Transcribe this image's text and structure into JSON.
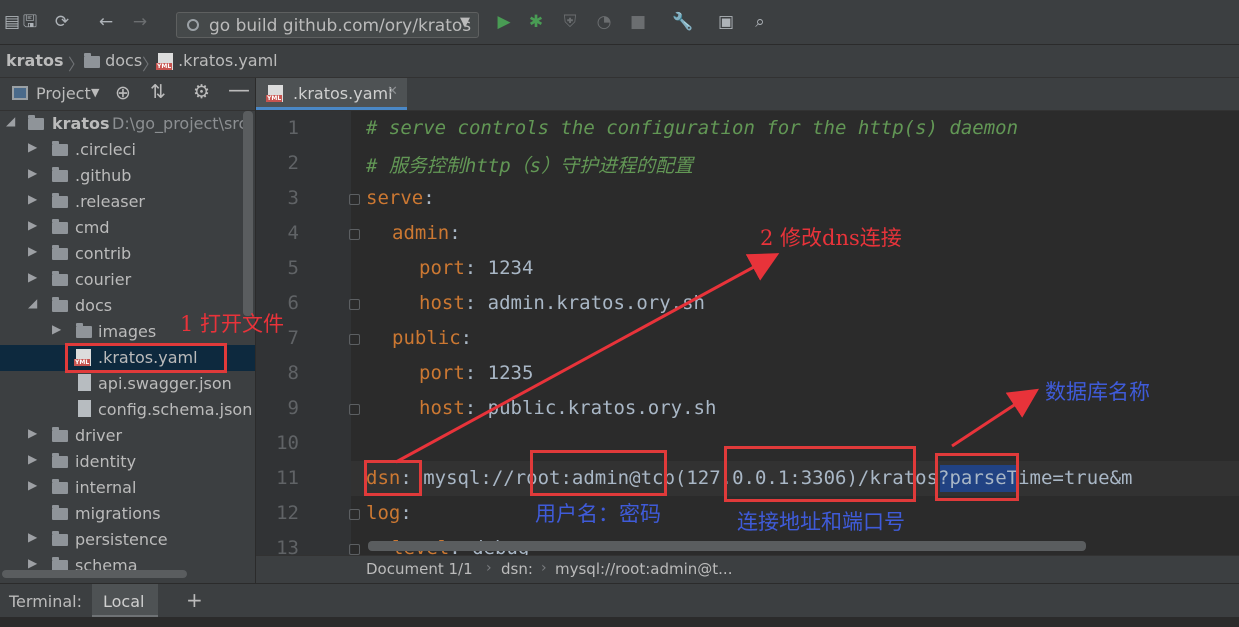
{
  "toolbar": {
    "run_config_label": "go build github.com/ory/kratos",
    "icons": [
      "save-icon",
      "sync-icon",
      "back-arrow-icon",
      "forward-arrow-icon",
      "run-icon",
      "debug-icon",
      "coverage-icon",
      "profile-icon",
      "stop-icon",
      "wrench-icon",
      "structure-icon",
      "search-icon"
    ]
  },
  "breadcrumb": {
    "items": [
      "kratos",
      "docs",
      ".kratos.yaml"
    ]
  },
  "project_panel": {
    "view_label": "Project",
    "root_name": "kratos",
    "root_path": "D:\\go_project\\src\\",
    "items": [
      {
        "label": ".circleci"
      },
      {
        "label": ".github"
      },
      {
        "label": ".releaser"
      },
      {
        "label": "cmd"
      },
      {
        "label": "contrib"
      },
      {
        "label": "courier"
      },
      {
        "label": "docs"
      },
      {
        "label": "images"
      },
      {
        "label": ".kratos.yaml"
      },
      {
        "label": "api.swagger.json"
      },
      {
        "label": "config.schema.json"
      },
      {
        "label": "driver"
      },
      {
        "label": "identity"
      },
      {
        "label": "internal"
      },
      {
        "label": "migrations"
      },
      {
        "label": "persistence"
      },
      {
        "label": "schema"
      }
    ]
  },
  "editor": {
    "tab_label": ".kratos.yaml",
    "line_numbers": [
      "1",
      "2",
      "3",
      "4",
      "5",
      "6",
      "7",
      "8",
      "9",
      "10",
      "11",
      "12",
      "13"
    ],
    "lines": {
      "l1": "# serve controls the configuration for the http(s) daemon",
      "l2": "# 服务控制http（s）守护进程的配置",
      "l3_key": "serve",
      "l4_key": "admin",
      "l5_key": "port",
      "l5_val": "1234",
      "l6_key": "host",
      "l6_val": "admin.kratos.ory.sh",
      "l7_key": "public",
      "l8_key": "port",
      "l8_val": "1235",
      "l9_key": "host",
      "l9_val": "public.kratos.ory.sh",
      "l11_key": "dsn",
      "l11_scheme": "mysql://",
      "l11_user": "root:admin",
      "l11_mid": "@tcp(",
      "l11_host": "127.0.0.1:3306",
      "l11_close": ")/",
      "l11_db": "kratos",
      "l11_rest": "?parseTime=true&m",
      "l12_key": "log",
      "l13_key": "level",
      "l13_val": "debug"
    }
  },
  "status_bar": {
    "document": "Document 1/1",
    "crumb1": "dsn:",
    "crumb2": "mysql://root:admin@t..."
  },
  "terminal": {
    "label": "Terminal:",
    "tab": "Local",
    "add": "+"
  },
  "annotations": {
    "open_file": "1 打开文件",
    "edit_dsn": "2 修改dns连接",
    "db_name": "数据库名称",
    "user_pass": "用户名：密码",
    "address_port": "连接地址和端口号"
  },
  "colors": {
    "annotation_red": "#e8333a",
    "annotation_blue": "#3f5bd9",
    "selection": "#214283"
  }
}
